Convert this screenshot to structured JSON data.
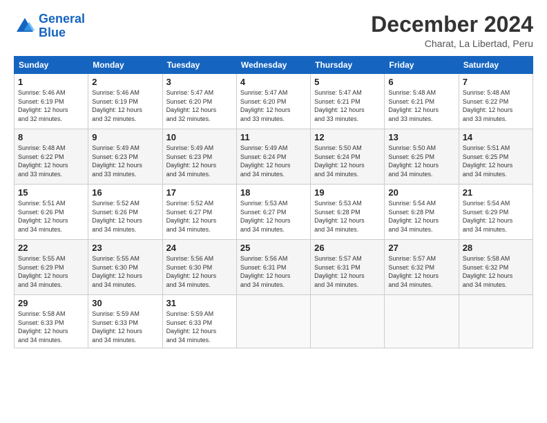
{
  "header": {
    "logo_line1": "General",
    "logo_line2": "Blue",
    "title": "December 2024",
    "subtitle": "Charat, La Libertad, Peru"
  },
  "calendar": {
    "days_of_week": [
      "Sunday",
      "Monday",
      "Tuesday",
      "Wednesday",
      "Thursday",
      "Friday",
      "Saturday"
    ],
    "weeks": [
      [
        {
          "day": "",
          "info": ""
        },
        {
          "day": "2",
          "info": "Sunrise: 5:46 AM\nSunset: 6:19 PM\nDaylight: 12 hours\nand 32 minutes."
        },
        {
          "day": "3",
          "info": "Sunrise: 5:47 AM\nSunset: 6:20 PM\nDaylight: 12 hours\nand 32 minutes."
        },
        {
          "day": "4",
          "info": "Sunrise: 5:47 AM\nSunset: 6:20 PM\nDaylight: 12 hours\nand 33 minutes."
        },
        {
          "day": "5",
          "info": "Sunrise: 5:47 AM\nSunset: 6:21 PM\nDaylight: 12 hours\nand 33 minutes."
        },
        {
          "day": "6",
          "info": "Sunrise: 5:48 AM\nSunset: 6:21 PM\nDaylight: 12 hours\nand 33 minutes."
        },
        {
          "day": "7",
          "info": "Sunrise: 5:48 AM\nSunset: 6:22 PM\nDaylight: 12 hours\nand 33 minutes."
        }
      ],
      [
        {
          "day": "8",
          "info": "Sunrise: 5:48 AM\nSunset: 6:22 PM\nDaylight: 12 hours\nand 33 minutes."
        },
        {
          "day": "9",
          "info": "Sunrise: 5:49 AM\nSunset: 6:23 PM\nDaylight: 12 hours\nand 33 minutes."
        },
        {
          "day": "10",
          "info": "Sunrise: 5:49 AM\nSunset: 6:23 PM\nDaylight: 12 hours\nand 34 minutes."
        },
        {
          "day": "11",
          "info": "Sunrise: 5:49 AM\nSunset: 6:24 PM\nDaylight: 12 hours\nand 34 minutes."
        },
        {
          "day": "12",
          "info": "Sunrise: 5:50 AM\nSunset: 6:24 PM\nDaylight: 12 hours\nand 34 minutes."
        },
        {
          "day": "13",
          "info": "Sunrise: 5:50 AM\nSunset: 6:25 PM\nDaylight: 12 hours\nand 34 minutes."
        },
        {
          "day": "14",
          "info": "Sunrise: 5:51 AM\nSunset: 6:25 PM\nDaylight: 12 hours\nand 34 minutes."
        }
      ],
      [
        {
          "day": "15",
          "info": "Sunrise: 5:51 AM\nSunset: 6:26 PM\nDaylight: 12 hours\nand 34 minutes."
        },
        {
          "day": "16",
          "info": "Sunrise: 5:52 AM\nSunset: 6:26 PM\nDaylight: 12 hours\nand 34 minutes."
        },
        {
          "day": "17",
          "info": "Sunrise: 5:52 AM\nSunset: 6:27 PM\nDaylight: 12 hours\nand 34 minutes."
        },
        {
          "day": "18",
          "info": "Sunrise: 5:53 AM\nSunset: 6:27 PM\nDaylight: 12 hours\nand 34 minutes."
        },
        {
          "day": "19",
          "info": "Sunrise: 5:53 AM\nSunset: 6:28 PM\nDaylight: 12 hours\nand 34 minutes."
        },
        {
          "day": "20",
          "info": "Sunrise: 5:54 AM\nSunset: 6:28 PM\nDaylight: 12 hours\nand 34 minutes."
        },
        {
          "day": "21",
          "info": "Sunrise: 5:54 AM\nSunset: 6:29 PM\nDaylight: 12 hours\nand 34 minutes."
        }
      ],
      [
        {
          "day": "22",
          "info": "Sunrise: 5:55 AM\nSunset: 6:29 PM\nDaylight: 12 hours\nand 34 minutes."
        },
        {
          "day": "23",
          "info": "Sunrise: 5:55 AM\nSunset: 6:30 PM\nDaylight: 12 hours\nand 34 minutes."
        },
        {
          "day": "24",
          "info": "Sunrise: 5:56 AM\nSunset: 6:30 PM\nDaylight: 12 hours\nand 34 minutes."
        },
        {
          "day": "25",
          "info": "Sunrise: 5:56 AM\nSunset: 6:31 PM\nDaylight: 12 hours\nand 34 minutes."
        },
        {
          "day": "26",
          "info": "Sunrise: 5:57 AM\nSunset: 6:31 PM\nDaylight: 12 hours\nand 34 minutes."
        },
        {
          "day": "27",
          "info": "Sunrise: 5:57 AM\nSunset: 6:32 PM\nDaylight: 12 hours\nand 34 minutes."
        },
        {
          "day": "28",
          "info": "Sunrise: 5:58 AM\nSunset: 6:32 PM\nDaylight: 12 hours\nand 34 minutes."
        }
      ],
      [
        {
          "day": "29",
          "info": "Sunrise: 5:58 AM\nSunset: 6:33 PM\nDaylight: 12 hours\nand 34 minutes."
        },
        {
          "day": "30",
          "info": "Sunrise: 5:59 AM\nSunset: 6:33 PM\nDaylight: 12 hours\nand 34 minutes."
        },
        {
          "day": "31",
          "info": "Sunrise: 5:59 AM\nSunset: 6:33 PM\nDaylight: 12 hours\nand 34 minutes."
        },
        {
          "day": "",
          "info": ""
        },
        {
          "day": "",
          "info": ""
        },
        {
          "day": "",
          "info": ""
        },
        {
          "day": "",
          "info": ""
        }
      ]
    ],
    "week1_day1": {
      "day": "1",
      "info": "Sunrise: 5:46 AM\nSunset: 6:19 PM\nDaylight: 12 hours\nand 32 minutes."
    }
  }
}
